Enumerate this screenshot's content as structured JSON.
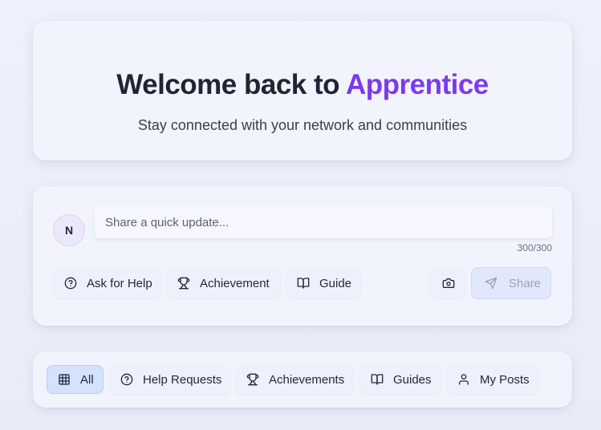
{
  "hero": {
    "title_prefix": "Welcome back to ",
    "title_brand": "Apprentice",
    "subtitle": "Stay connected with your network and communities"
  },
  "composer": {
    "avatar_initial": "N",
    "placeholder": "Share a quick update...",
    "char_count": "300/300",
    "buttons": {
      "ask_help": "Ask for Help",
      "achievement": "Achievement",
      "guide": "Guide",
      "share": "Share"
    }
  },
  "filters": {
    "all": "All",
    "help_requests": "Help Requests",
    "achievements": "Achievements",
    "guides": "Guides",
    "my_posts": "My Posts",
    "selected": "All"
  },
  "icons": {
    "ask_help": "help-circle-icon",
    "achievement": "trophy-icon",
    "guide": "book-open-icon",
    "camera": "camera-icon",
    "share": "send-icon",
    "all": "grid-icon",
    "my_posts": "user-icon"
  },
  "colors": {
    "brand_accent": "#7c3aed",
    "selected_filter_bg": "#d4e2fb",
    "share_disabled_bg": "#e1e8fb"
  }
}
